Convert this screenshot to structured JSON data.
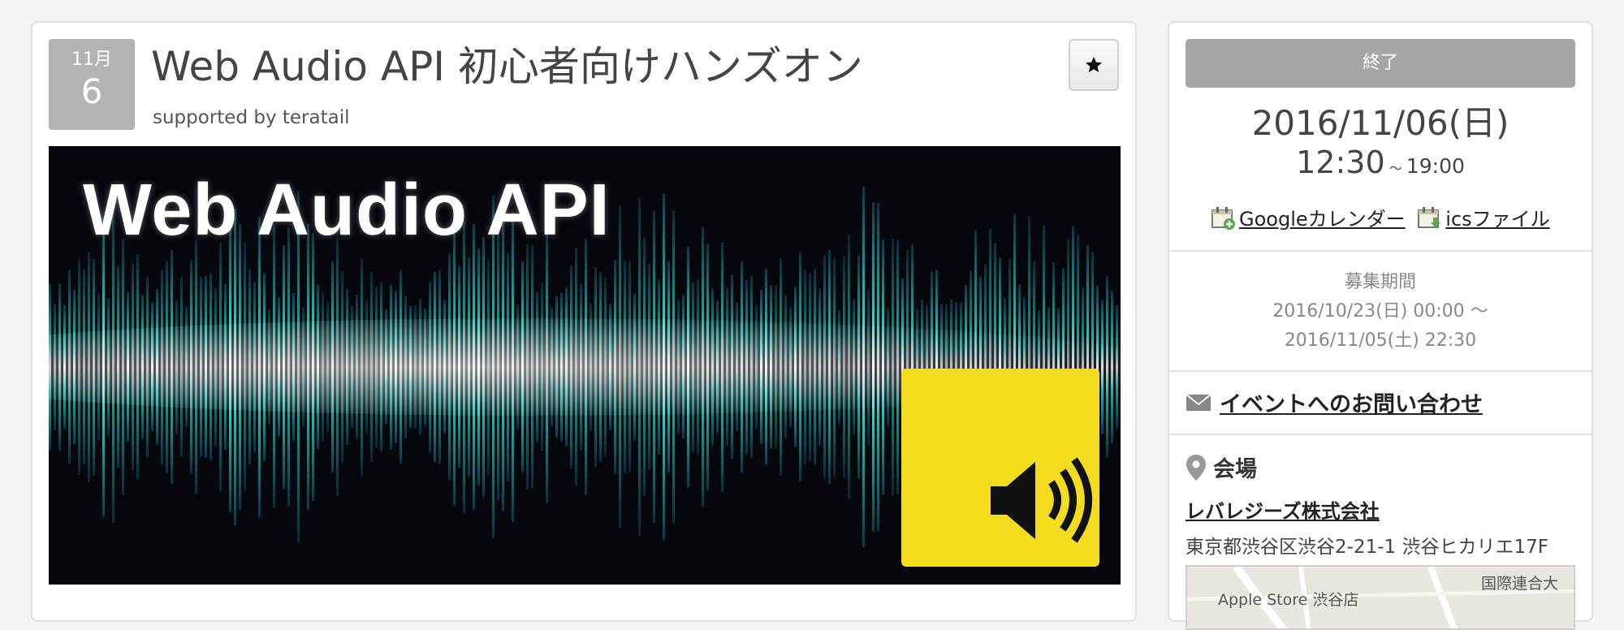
{
  "event": {
    "month": "11月",
    "day": "6",
    "title": "Web Audio API 初心者向けハンズオン",
    "subtitle": "supported by teratail",
    "banner_text": "Web Audio API"
  },
  "sidebar": {
    "status": "終了",
    "date": "2016/11/06(日)",
    "time_start": "12:30",
    "time_sep": "～",
    "time_end": "19:00",
    "google_calendar": "Googleカレンダー",
    "ics_file": "icsファイル",
    "recruit_label": "募集期間",
    "recruit_start": "2016/10/23(日) 00:00 ～",
    "recruit_end": "2016/11/05(土) 22:30",
    "contact": "イベントへのお問い合わせ",
    "venue_label": "会場",
    "venue_name": "レバレジーズ株式会社",
    "venue_address": "東京都渋谷区渋谷2-21-1 渋谷ヒカリエ17F",
    "map_labels": [
      "Apple Store 渋谷店",
      "国際連合大"
    ]
  },
  "icons": {
    "star": "star-icon",
    "google_calendar": "calendar-add-icon",
    "ics": "calendar-download-icon",
    "mail": "mail-icon",
    "location": "map-pin-icon",
    "speaker": "speaker-icon"
  },
  "colors": {
    "badge": "#b3b3b3",
    "status": "#a6a6a6",
    "speaker_tile": "#f4dc1f",
    "wave": "#2ad6c4"
  }
}
